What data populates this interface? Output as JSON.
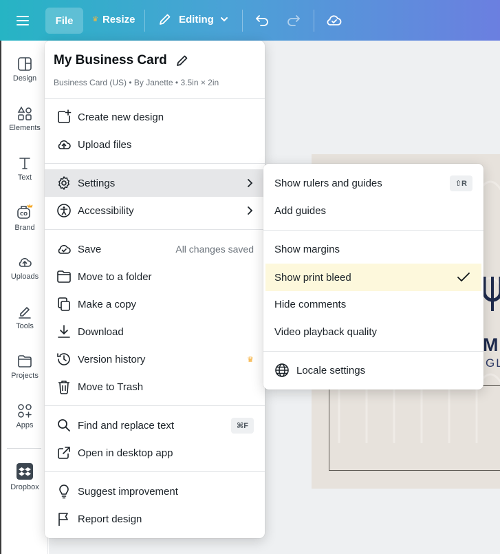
{
  "topbar": {
    "file_label": "File",
    "resize_label": "Resize",
    "editing_label": "Editing"
  },
  "rail": {
    "items": [
      {
        "label": "Design",
        "icon": "design-icon"
      },
      {
        "label": "Elements",
        "icon": "elements-icon"
      },
      {
        "label": "Text",
        "icon": "text-icon"
      },
      {
        "label": "Brand",
        "icon": "brand-icon"
      },
      {
        "label": "Uploads",
        "icon": "uploads-icon"
      },
      {
        "label": "Tools",
        "icon": "tools-icon"
      },
      {
        "label": "Projects",
        "icon": "projects-icon"
      },
      {
        "label": "Apps",
        "icon": "apps-icon"
      },
      {
        "label": "Dropbox",
        "icon": "dropbox-icon"
      }
    ]
  },
  "file_menu": {
    "title": "My Business Card",
    "subtitle": "Business Card (US) • By Janette • 3.5in × 2in",
    "items": [
      {
        "label": "Create new design",
        "icon": "new-design-icon"
      },
      {
        "label": "Upload files",
        "icon": "upload-cloud-icon"
      },
      {
        "label": "Settings",
        "icon": "gear-icon"
      },
      {
        "label": "Accessibility",
        "icon": "accessibility-icon"
      },
      {
        "label": "Save",
        "icon": "save-cloud-icon",
        "right": "All changes saved"
      },
      {
        "label": "Move to a folder",
        "icon": "folder-icon"
      },
      {
        "label": "Make a copy",
        "icon": "copy-icon"
      },
      {
        "label": "Download",
        "icon": "download-icon"
      },
      {
        "label": "Version history",
        "icon": "history-icon"
      },
      {
        "label": "Move to Trash",
        "icon": "trash-icon"
      },
      {
        "label": "Find and replace text",
        "icon": "search-icon",
        "shortcut": "⌘F"
      },
      {
        "label": "Open in desktop app",
        "icon": "external-link-icon"
      },
      {
        "label": "Suggest improvement",
        "icon": "lightbulb-icon"
      },
      {
        "label": "Report design",
        "icon": "flag-icon"
      }
    ]
  },
  "settings_menu": {
    "items": [
      {
        "label": "Show rulers and guides",
        "shortcut": "⇧R"
      },
      {
        "label": "Add guides"
      },
      {
        "label": "Show margins"
      },
      {
        "label": "Show print bleed",
        "checked": true
      },
      {
        "label": "Hide comments"
      },
      {
        "label": "Video playback quality"
      },
      {
        "label": "Locale settings",
        "icon": "globe-icon"
      }
    ]
  },
  "canvas": {
    "logo_line1": "MP",
    "logo_line2": "GLI"
  },
  "colors": {
    "topbar_start": "#26b4c4",
    "topbar_end": "#6b7fe0",
    "highlight_row": "#fdf8dc",
    "premium_crown": "#f5a623"
  }
}
